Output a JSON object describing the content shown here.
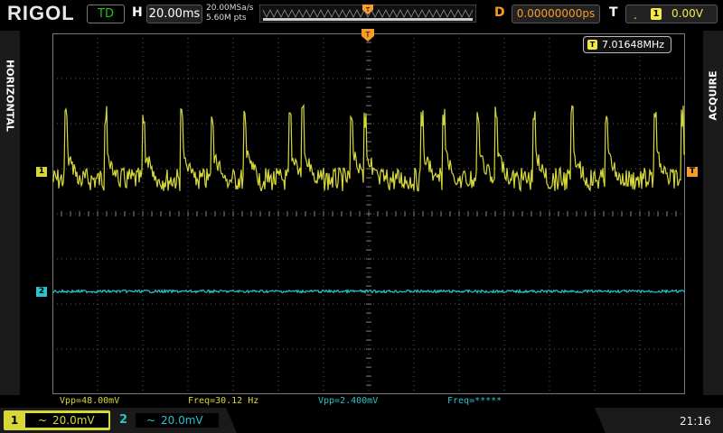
{
  "header": {
    "logo": "RIGOL",
    "run_state": "TD",
    "horizontal_label": "H",
    "timebase": "20.00ms",
    "sample_rate": "20.00MSa/s",
    "memory_depth": "5.60M pts",
    "delay_label": "D",
    "delay_value": "0.00000000ps",
    "trigger_label": "T",
    "trigger_channel": "1",
    "trigger_level": "0.00V"
  },
  "side_labels": {
    "left": "HORIZONTAL",
    "right": "ACQUIRE"
  },
  "counter": {
    "value": "7.01648MHz"
  },
  "channel_markers": {
    "ch1": "1",
    "ch2": "2",
    "trigger": "T"
  },
  "measurements": {
    "ch1_vpp": "Vpp=48.00mV",
    "ch1_freq": "Freq=30.12 Hz",
    "ch2_vpp": "Vpp=2.400mV",
    "ch2_freq": "Freq=*****"
  },
  "channels": [
    {
      "number": "1",
      "coupling": "~",
      "scale": "20.0mV"
    },
    {
      "number": "2",
      "coupling": "~",
      "scale": "20.0mV"
    }
  ],
  "clock": "21:16",
  "colors": {
    "ch1": "#d6d83a",
    "ch2": "#2bc3c9",
    "trigger": "#f79b2c",
    "grid": "#5a5a5a"
  }
}
